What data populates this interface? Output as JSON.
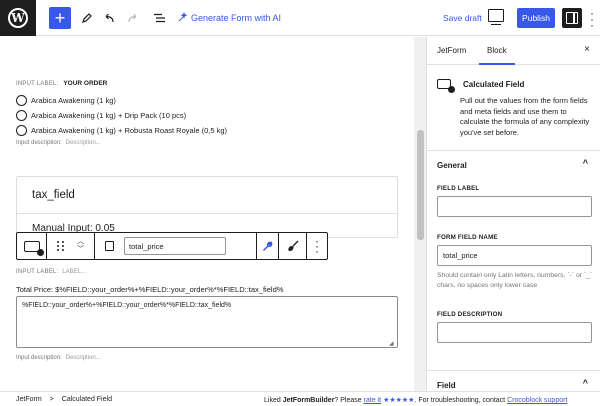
{
  "toolbar": {
    "wp_logo": "W",
    "add_icon": "+",
    "generate_form_label": "Generate Form with AI",
    "save_draft_label": "Save draft",
    "publish_label": "Publish",
    "icons": [
      "wordpress-logo",
      "plus-icon",
      "pencil-icon",
      "undo-icon",
      "redo-icon",
      "list-view-icon",
      "sparkle-icon",
      "preview-icon",
      "settings-icon",
      "more-icon"
    ]
  },
  "canvas": {
    "radio_field": {
      "input_label_caption": "INPUT LABEL:",
      "input_label_value": "YOUR ORDER",
      "options": [
        "Arabica Awakening (1 kg)",
        "Arabica Awakening (1 kg) + Drip Pack (10 pcs)",
        "Arabica Awakening (1 kg) + Robusta Roast Royale (0,5 kg)"
      ],
      "description_caption": "Input description:",
      "description_placeholder": "Description..."
    },
    "tax_block": {
      "name": "tax_field",
      "manual_input": "Manual Input: 0.05"
    },
    "block_toolbar": {
      "field_name_value": "total_price"
    },
    "calc_field": {
      "input_label_caption": "INPUT LABEL:",
      "input_label_placeholder": "LABEL...",
      "total_text": "Total Price: $%FIELD::your_order%+%FIELD::your_order%*%FIELD::tax_field%",
      "formula": "%FIELD::your_order%+%FIELD::your_order%*%FIELD::tax_field%",
      "description_caption": "Input description:",
      "description_placeholder": "Description..."
    }
  },
  "sidebar": {
    "tabs": [
      {
        "label": "JetForm"
      },
      {
        "label": "Block"
      }
    ],
    "close_icon": "×",
    "block_card": {
      "title": "Calculated Field",
      "description": "Pull out the values from the form fields and meta fields and use them to calculate the formula of any complexity you've set before."
    },
    "general_section": {
      "title": "General",
      "field_label_caption": "FIELD LABEL",
      "field_label_value": "",
      "form_field_name_caption": "FORM FIELD NAME",
      "form_field_name_value": "total_price",
      "form_field_name_help": "Should contain only Latin letters, numbers, `-` or `_` chars, no spaces only lower case",
      "field_description_caption": "FIELD DESCRIPTION",
      "field_description_value": ""
    },
    "field_section": {
      "title": "Field"
    },
    "chevron": "^"
  },
  "footer": {
    "breadcrumb": [
      "JetForm",
      "Calculated Field"
    ],
    "breadcrumb_sep": ">",
    "msg_prefix": "Liked ",
    "msg_brand": "JetFormBuilder",
    "msg_mid": "? Please ",
    "msg_rate": "rate it",
    "msg_stars": "★★★★★",
    "msg_suffix": ". For troubleshooting, contact ",
    "msg_link": "Crocoblock support"
  },
  "colors": {
    "accent": "#3858e9",
    "dark": "#1e1e1e",
    "muted": "#757575"
  }
}
